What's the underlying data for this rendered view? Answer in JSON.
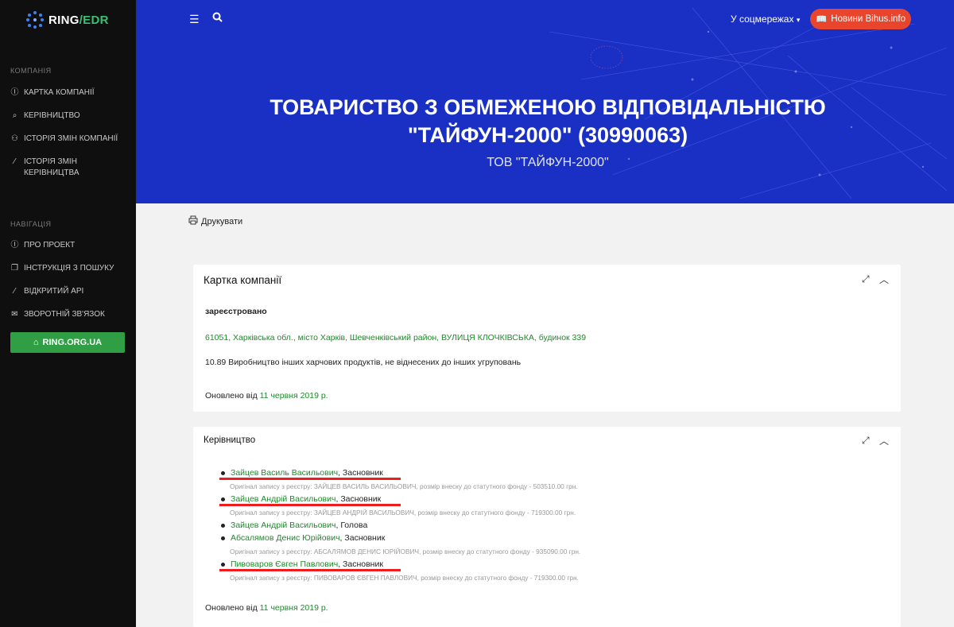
{
  "logo": {
    "ring": "RING",
    "slash": "/",
    "edr": "EDR"
  },
  "sidebar": {
    "section_company": "КОМПАНІЯ",
    "company_items": [
      {
        "label": "КАРТКА КОМПАНІЇ",
        "icon": "info-circle-icon"
      },
      {
        "label": "КЕРІВНИЦТВО",
        "icon": "search-person-icon"
      },
      {
        "label": "ІСТОРІЯ ЗМІН КОМПАНІЇ",
        "icon": "person-history-icon"
      },
      {
        "label": "ІСТОРІЯ ЗМІН КЕРІВНИЦТВА",
        "icon": "wand-icon"
      }
    ],
    "section_nav": "НАВІГАЦІЯ",
    "nav_items": [
      {
        "label": "ПРО ПРОЕКТ",
        "icon": "info-circle-icon"
      },
      {
        "label": "ІНСТРУКЦІЯ З ПОШУКУ",
        "icon": "copy-icon"
      },
      {
        "label": "ВІДКРИТИЙ API",
        "icon": "wand-icon"
      },
      {
        "label": "ЗВОРОТНІЙ ЗВ'ЯЗОК",
        "icon": "envelope-icon"
      }
    ],
    "ring_button": "RING.ORG.UA"
  },
  "header": {
    "social_label": "У соцмережах",
    "news_button": "Новини Bihus.info",
    "title_line1": "ТОВАРИСТВО З ОБМЕЖЕНОЮ ВІДПОВІДАЛЬНІСТЮ",
    "title_line2": "\"ТАЙФУН-2000\" (30990063)",
    "subtitle": "ТОВ \"ТАЙФУН-2000\""
  },
  "print_label": "Друкувати",
  "company_card": {
    "title": "Картка компанії",
    "status": "зареєстровано",
    "address": "61051, Харківська обл., місто Харків, Шевченківський район, ВУЛИЦЯ КЛОЧКІВСЬКА, будинок 339",
    "activity": "10.89 Виробництво інших харчових продуктів, не віднесених до інших угруповань",
    "updated_label": "Оновлено від",
    "updated_date": "11 червня 2019 р."
  },
  "management_card": {
    "title": "Керівництво",
    "people": [
      {
        "name": "Зайцев Василь Васильович",
        "role": ", Засновник",
        "orig": "Оригінал запису з реєстру: ЗАЙЦЕВ ВАСИЛЬ ВАСИЛЬОВИЧ, розмір внеску до статутного фонду - 503510.00 грн.",
        "highlighted": true
      },
      {
        "name": "Зайцев Андрій Васильович",
        "role": ", Засновник",
        "orig": "Оригінал запису з реєстру: ЗАЙЦЕВ АНДРІЙ ВАСИЛЬОВИЧ, розмір внеску до статутного фонду - 719300.00 грн.",
        "highlighted": true
      },
      {
        "name": "Зайцев Андрій Васильович",
        "role": ", Голова",
        "orig": "",
        "highlighted": false
      },
      {
        "name": "Абсалямов Денис Юрійович",
        "role": ", Засновник",
        "orig": "Оригінал запису з реєстру: АБСАЛЯМОВ ДЕНИС ЮРІЙОВИЧ, розмір внеску до статутного фонду - 935090.00 грн.",
        "highlighted": false
      },
      {
        "name": "Пивоваров Євген Павлович",
        "role": ", Засновник",
        "orig": "Оригінал запису з реєстру: ПИВОВАРОВ ЄВГЕН ПАВЛОВИЧ, розмір внеску до статутного фонду - 719300.00 грн.",
        "highlighted": true
      }
    ],
    "updated_label": "Оновлено від",
    "updated_date": "11 червня 2019 р."
  },
  "colors": {
    "banner": "#1a2fc4",
    "accent_green": "#1f8a2c",
    "news_red": "#e8452c",
    "highlight": "#ee1c1c"
  }
}
